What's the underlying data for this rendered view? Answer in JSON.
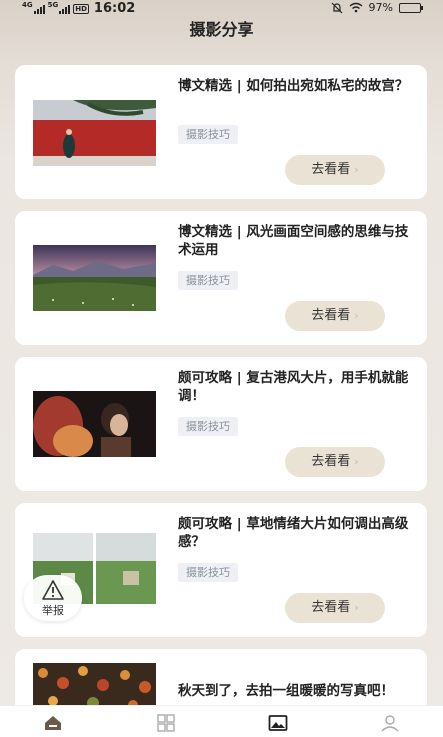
{
  "status_bar": {
    "network1": "4G",
    "network2": "5G",
    "hd": "HD",
    "time": "16:02",
    "battery": "97%",
    "battery_level": 0.97
  },
  "page_title": "摄影分享",
  "articles": [
    {
      "title": "博文精选 | 如何拍出宛如私宅的故宫？",
      "tag": "摄影技巧",
      "button": "去看看"
    },
    {
      "title": "博文精选 | 风光画面空间感的思维与技术运用",
      "tag": "摄影技巧",
      "button": "去看看"
    },
    {
      "title": "颇可攻略 | 复古港风大片，用手机就能调！",
      "tag": "摄影技巧",
      "button": "去看看"
    },
    {
      "title": "颇可攻略 | 草地情绪大片如何调出高级感？",
      "tag": "摄影技巧",
      "button": "去看看"
    },
    {
      "title": "秋天到了，去拍一组暖暖的写真吧！"
    }
  ],
  "report_label": "举报",
  "tabbar": {
    "items": [
      {
        "icon": "home-icon",
        "active": false
      },
      {
        "icon": "grid-icon",
        "active": false
      },
      {
        "icon": "image-icon",
        "active": true
      },
      {
        "icon": "user-icon",
        "active": false
      }
    ]
  },
  "colors": {
    "button_bg": "#ebe2d6",
    "tag_bg": "#eef0f6",
    "tag_text": "#8a8f99",
    "page_bg": "#ede9e4"
  }
}
